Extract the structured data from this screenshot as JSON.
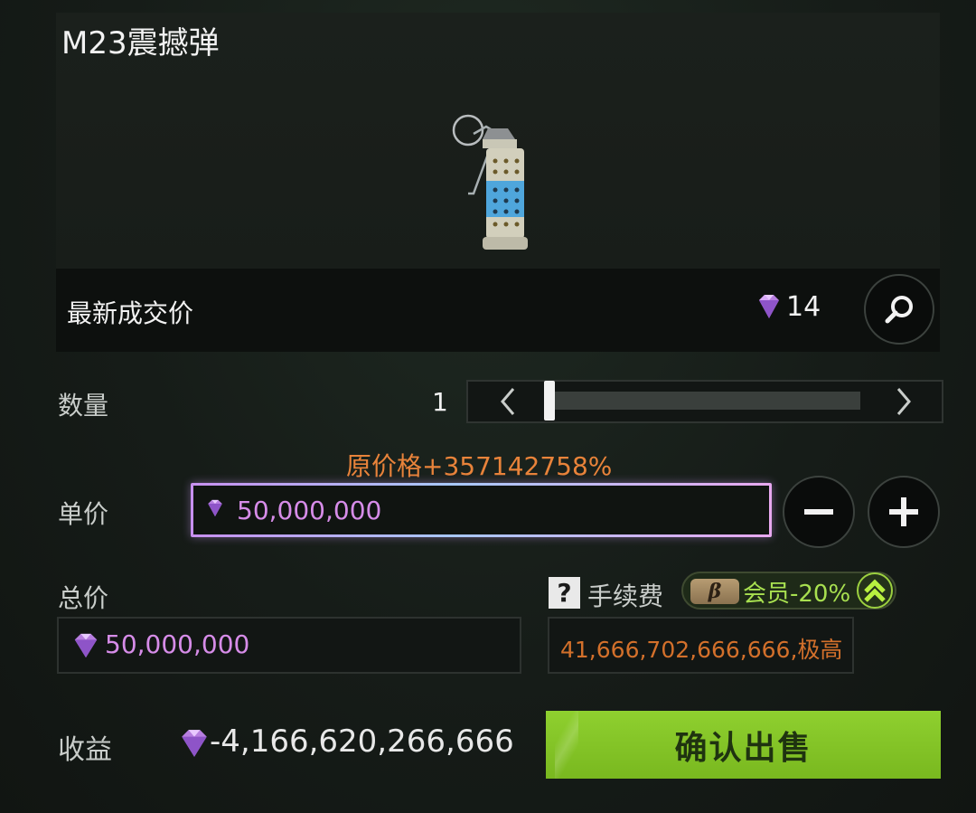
{
  "item": {
    "title": "M23震撼弹",
    "icon": "stun-grenade-icon"
  },
  "latest_price": {
    "label": "最新成交价",
    "value": "14",
    "icon": "diamond-icon"
  },
  "quantity": {
    "label": "数量",
    "value": "1",
    "slider_fraction": 0.0
  },
  "markup_text": "原价格+357142758%",
  "unit_price": {
    "label": "单价",
    "value": "50,000,000"
  },
  "total_price": {
    "label": "总价",
    "value": "50,000,000"
  },
  "fee": {
    "label": "手续费",
    "help_icon": "?",
    "member_tag": "β",
    "member_text": "会员-20%",
    "value": "41,666,702,666,666,极高"
  },
  "profit": {
    "label": "收益",
    "value": "-4,166,620,266,666"
  },
  "confirm_label": "确认出售",
  "colors": {
    "accent_green": "#85c626",
    "diamond": "#c58ae8",
    "warning_orange": "#e8833a"
  }
}
